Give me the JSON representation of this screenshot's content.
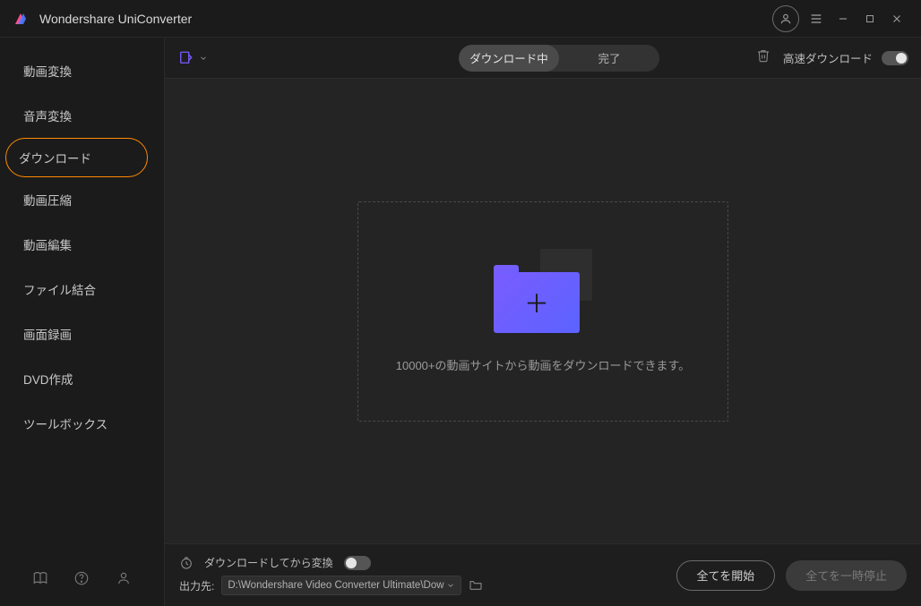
{
  "app": {
    "title": "Wondershare UniConverter"
  },
  "sidebar": {
    "items": [
      {
        "label": "動画変換"
      },
      {
        "label": "音声変換"
      },
      {
        "label": "ダウンロード"
      },
      {
        "label": "動画圧縮"
      },
      {
        "label": "動画編集"
      },
      {
        "label": "ファイル結合"
      },
      {
        "label": "画面録画"
      },
      {
        "label": "DVD作成"
      },
      {
        "label": "ツールボックス"
      }
    ]
  },
  "toolbar": {
    "tabs": {
      "downloading": "ダウンロード中",
      "completed": "完了"
    },
    "speed_label": "高速ダウンロード"
  },
  "dropzone": {
    "text": "10000+の動画サイトから動画をダウンロードできます。"
  },
  "bottombar": {
    "convert_after_label": "ダウンロードしてから変換",
    "output_label": "出力先:",
    "output_path": "D:\\Wondershare Video Converter Ultimate\\Dow",
    "start_all": "全てを開始",
    "pause_all": "全てを一時停止"
  }
}
